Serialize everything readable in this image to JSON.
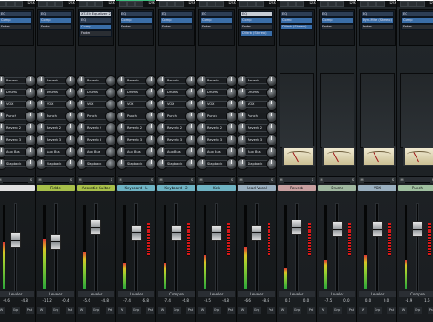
{
  "top_tabs": [
    {
      "label": "Dsk",
      "color": "#ffffff"
    },
    {
      "label": "Dsk",
      "color": "#ffffff"
    },
    {
      "label": "Dsk",
      "color": "#ffffff"
    },
    {
      "label": "Dsk",
      "color": "#3fbf7f"
    },
    {
      "label": "Dsk",
      "color": "#ffffff"
    },
    {
      "label": "Dsk",
      "color": "#ffffff"
    },
    {
      "label": "Dsk",
      "color": "#ffffff"
    },
    {
      "label": "Dsk",
      "color": "#ffffff"
    },
    {
      "label": "Dsk",
      "color": "#ffffff"
    }
  ],
  "channels": [
    {
      "name": "",
      "name_color": "#e0e0e0",
      "inserts": [
        "EQ",
        "Comp",
        "Fader"
      ],
      "sends": [
        "Reverb",
        "Drums",
        "VOX",
        "Punch",
        "Reverb 2",
        "Reverb 3",
        "Aux Bus",
        "Slapback"
      ],
      "value_left": "-0.6",
      "value_right": "-4.8",
      "bottom_label": "Leveler",
      "meter": 0.55,
      "fader": 0.6,
      "type": "track"
    },
    {
      "name": "Fiddle",
      "name_color": "#a8c04a",
      "inserts": [
        "EQ",
        "Comp",
        "Fader"
      ],
      "sends": [
        "Reverb",
        "Drums",
        "VOX",
        "Punch",
        "Reverb 2",
        "Reverb 3",
        "Aux Bus",
        "Slapback"
      ],
      "value_left": "-11.2",
      "value_right": "-0.4",
      "bottom_label": "Leveler",
      "meter": 0.6,
      "fader": 0.58,
      "type": "track"
    },
    {
      "name": "Acoustic Guitar",
      "name_color": "#a8c04a",
      "inserts": [
        "XT-EQ Equalizer 2",
        "EQ",
        "Comp",
        "Fader"
      ],
      "sends": [
        "Reverb",
        "Drums",
        "VOX",
        "Punch",
        "Reverb 2",
        "Reverb 3",
        "Aux Bus",
        "Slapback"
      ],
      "value_left": "-5.6",
      "value_right": "-4.8",
      "bottom_label": "Leveler",
      "meter": 0.45,
      "fader": 0.78,
      "type": "track"
    },
    {
      "name": "Keyboard - L",
      "name_color": "#6fb4c4",
      "inserts": [
        "EQ",
        "Comp",
        "Fader"
      ],
      "sends": [
        "Reverb",
        "Drums",
        "VOX",
        "Punch",
        "Reverb 2",
        "Reverb 3",
        "Aux Bus",
        "Slapback"
      ],
      "value_left": "-7.4",
      "value_right": "-6.8",
      "bottom_label": "Leveler",
      "meter": 0.3,
      "fader": 0.7,
      "type": "track"
    },
    {
      "name": "Keyboard - 2",
      "name_color": "#6fb4c4",
      "inserts": [
        "EQ",
        "Comp",
        "Fader"
      ],
      "sends": [
        "Reverb",
        "Drums",
        "VOX",
        "Punch",
        "Reverb 2",
        "Reverb 3",
        "Aux Bus",
        "Slapback"
      ],
      "value_left": "-7.4",
      "value_right": "-6.8",
      "bottom_label": "Compre",
      "meter": 0.3,
      "fader": 0.7,
      "type": "track"
    },
    {
      "name": "Kick",
      "name_color": "#6fb4c4",
      "inserts": [
        "EQ",
        "Comp",
        "Fader"
      ],
      "sends": [
        "Reverb",
        "Drums",
        "VOX",
        "Punch",
        "Reverb 2",
        "Reverb 3",
        "Aux Bus",
        "Slapback"
      ],
      "value_left": "-3.5",
      "value_right": "-4.8",
      "bottom_label": "Leveler",
      "meter": 0.4,
      "fader": 0.7,
      "type": "track"
    },
    {
      "name": "Lead Vocal",
      "name_color": "#9ab0c0",
      "inserts": [
        "EQ",
        "Comp",
        "Fader",
        "DVerb (Stereo)"
      ],
      "sends": [
        "Reverb",
        "Drums",
        "VOX",
        "Punch",
        "Reverb 2",
        "Reverb 3",
        "Aux Bus",
        "Slapback"
      ],
      "value_left": "-6.6",
      "value_right": "-8.8",
      "bottom_label": "Leveler",
      "meter": 0.5,
      "fader": 0.7,
      "type": "track"
    },
    {
      "name": "Reverb",
      "name_color": "#c9a0a0",
      "inserts": [
        "EQ",
        "Comp",
        "DVerb (Stereo)"
      ],
      "sends": [],
      "value_left": "0.1",
      "value_right": "0.0",
      "bottom_label": "Leveler",
      "meter": 0.25,
      "fader": 0.78,
      "type": "bus"
    },
    {
      "name": "Drums",
      "name_color": "#a0b8a0",
      "inserts": [
        "EQ",
        "Comp",
        "Fader"
      ],
      "sends": [],
      "value_left": "-7.5",
      "value_right": "0.0",
      "bottom_label": "Leveler",
      "meter": 0.35,
      "fader": 0.75,
      "type": "bus"
    },
    {
      "name": "VOX",
      "name_color": "#9ab0c0",
      "inserts": [
        "EQ",
        "Dyn-Mite (Stereo)",
        "Fader"
      ],
      "sends": [],
      "value_left": "0.0",
      "value_right": "0.0",
      "bottom_label": "Leveler",
      "meter": 0.4,
      "fader": 0.75,
      "type": "bus"
    },
    {
      "name": "Punch",
      "name_color": "#a0c0a0",
      "inserts": [
        "EQ",
        "Comp",
        "Fader"
      ],
      "sends": [],
      "value_left": "-1.9",
      "value_right": "1.6",
      "bottom_label": "Compre",
      "meter": 0.35,
      "fader": 0.75,
      "type": "bus"
    }
  ],
  "mute_label": "M",
  "solo_label": "S",
  "btn_labels": [
    "W",
    "Grp",
    "Pst"
  ],
  "colors": {
    "panel": "#1c2023",
    "accent_blue": "#3a6ea8",
    "insert_dark": "#2d3e55",
    "vu_face": "#eee6c8"
  }
}
